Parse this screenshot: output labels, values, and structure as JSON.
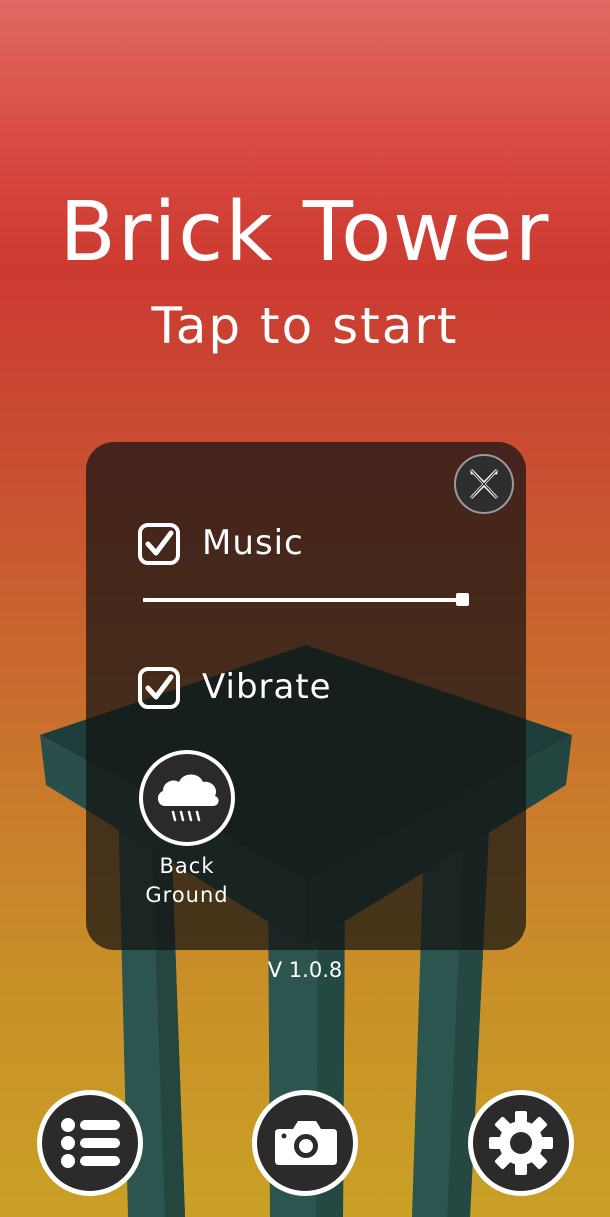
{
  "game": {
    "title": "Brick Tower",
    "subtitle": "Tap to start"
  },
  "settings_panel": {
    "close_icon": "close-icon",
    "music": {
      "label": "Music",
      "checked": true,
      "volume": 1.0
    },
    "vibrate": {
      "label": "Vibrate",
      "checked": true
    },
    "background_button": {
      "icon": "cloud-rain-icon",
      "label_line1": "Back",
      "label_line2": "Ground"
    }
  },
  "version": "V 1.0.8",
  "bottom_bar": {
    "left_icon": "list-icon",
    "center_icon": "camera-icon",
    "right_icon": "gear-icon"
  },
  "colors": {
    "tower": "#2c5550",
    "tower_top": "#1f3e3b",
    "panel": "#141414",
    "accent": "#ffffff"
  }
}
